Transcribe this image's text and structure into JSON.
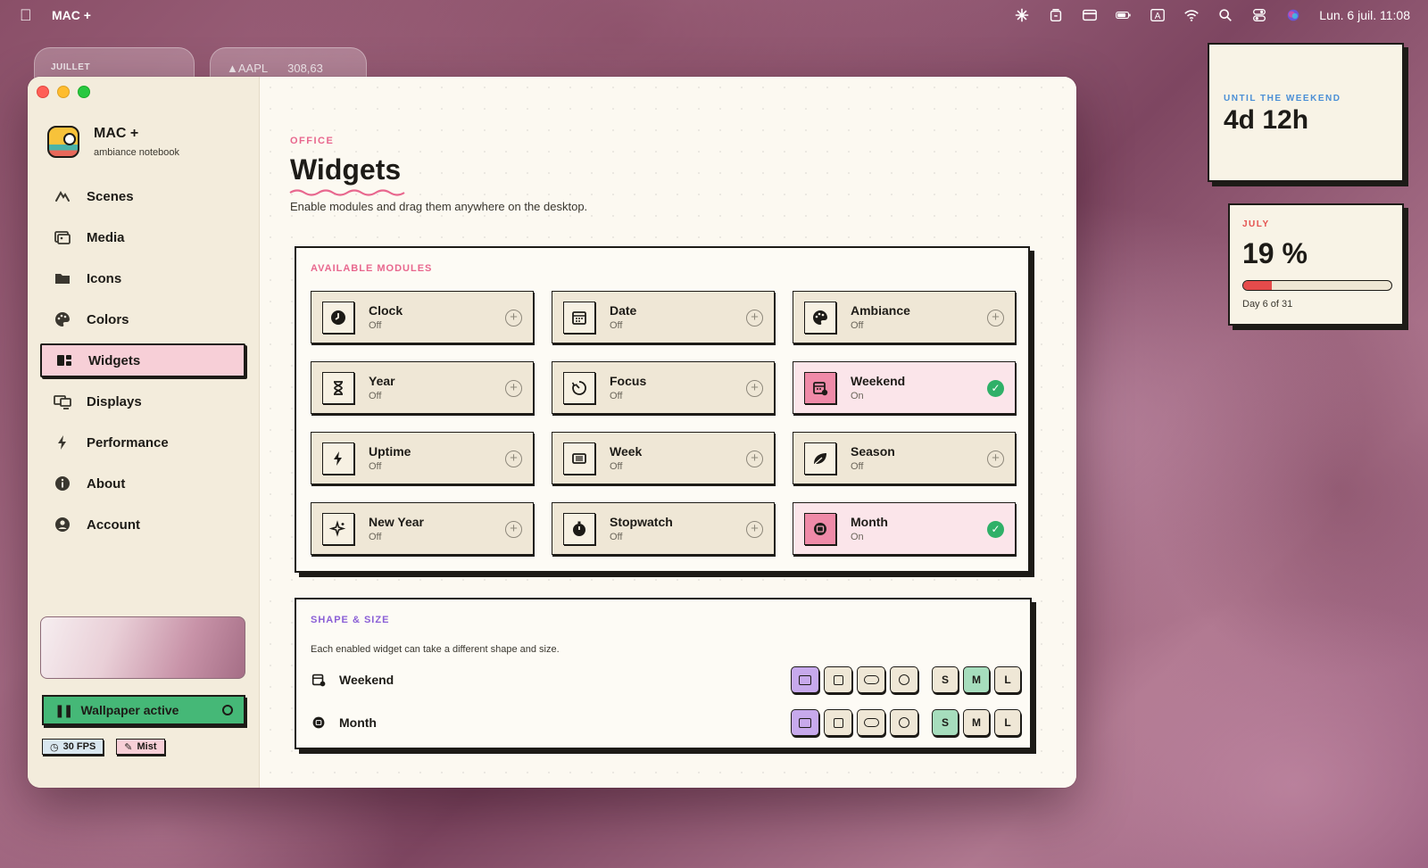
{
  "menubar": {
    "app_name": "MAC +",
    "datetime": "Lun. 6 juil.  11:08",
    "icons": [
      "sparkle-icon",
      "archive-icon",
      "card-icon",
      "battery-icon",
      "keyboard-a-icon",
      "wifi-icon",
      "search-icon",
      "control-center-icon",
      "siri-icon"
    ]
  },
  "background_widgets": {
    "month_label": "JUILLET",
    "stock_symbol": "▲AAPL",
    "stock_value": "308,63"
  },
  "sidebar": {
    "app_title": "MAC +",
    "app_subtitle": "ambiance notebook",
    "items": [
      {
        "label": "Scenes",
        "icon": "scenes-icon"
      },
      {
        "label": "Media",
        "icon": "media-icon"
      },
      {
        "label": "Icons",
        "icon": "folder-icon"
      },
      {
        "label": "Colors",
        "icon": "palette-icon"
      },
      {
        "label": "Widgets",
        "icon": "widgets-icon",
        "active": true
      },
      {
        "label": "Displays",
        "icon": "displays-icon"
      },
      {
        "label": "Performance",
        "icon": "bolt-icon"
      },
      {
        "label": "About",
        "icon": "info-icon"
      },
      {
        "label": "Account",
        "icon": "account-icon"
      }
    ],
    "wallpaper_button": "Wallpaper active",
    "fps_chip": "30 FPS",
    "mist_chip": "Mist"
  },
  "main": {
    "eyebrow": "OFFICE",
    "title": "Widgets",
    "subtitle": "Enable modules and drag them anywhere on the desktop.",
    "modules_heading": "AVAILABLE MODULES",
    "modules": [
      {
        "name": "Clock",
        "state": "Off",
        "icon": "clock-icon",
        "on": false
      },
      {
        "name": "Date",
        "state": "Off",
        "icon": "calendar-icon",
        "on": false
      },
      {
        "name": "Ambiance",
        "state": "Off",
        "icon": "palette-icon",
        "on": false
      },
      {
        "name": "Year",
        "state": "Off",
        "icon": "hourglass-icon",
        "on": false
      },
      {
        "name": "Focus",
        "state": "Off",
        "icon": "timer-icon",
        "on": false
      },
      {
        "name": "Weekend",
        "state": "On",
        "icon": "calendar-clock-icon",
        "on": true
      },
      {
        "name": "Uptime",
        "state": "Off",
        "icon": "bolt-icon",
        "on": false
      },
      {
        "name": "Week",
        "state": "Off",
        "icon": "week-icon",
        "on": false
      },
      {
        "name": "Season",
        "state": "Off",
        "icon": "leaf-icon",
        "on": false
      },
      {
        "name": "New Year",
        "state": "Off",
        "icon": "sparkle-icon",
        "on": false
      },
      {
        "name": "Stopwatch",
        "state": "Off",
        "icon": "stopwatch-icon",
        "on": false
      },
      {
        "name": "Month",
        "state": "On",
        "icon": "month-icon",
        "on": true
      }
    ],
    "shape_heading": "SHAPE & SIZE",
    "shape_desc": "Each enabled widget can take a different shape and size.",
    "shape_rows": [
      {
        "name": "Weekend",
        "icon": "calendar-clock-icon",
        "shape": "rect",
        "size": "M"
      },
      {
        "name": "Month",
        "icon": "month-icon",
        "shape": "rect",
        "size": "S"
      }
    ],
    "size_labels": [
      "S",
      "M",
      "L"
    ]
  },
  "desktop_widgets": {
    "weekend_label": "UNTIL THE WEEKEND",
    "weekend_value": "4d 12h",
    "month_label": "JULY",
    "month_value": "19 %",
    "month_progress": 0.19,
    "month_day": "Day 6 of 31"
  },
  "colors": {
    "accent_pink": "#e8678e",
    "accent_purple": "#8a5fd6",
    "on_green": "#2fb068",
    "active_nav": "#f7cfd7"
  }
}
